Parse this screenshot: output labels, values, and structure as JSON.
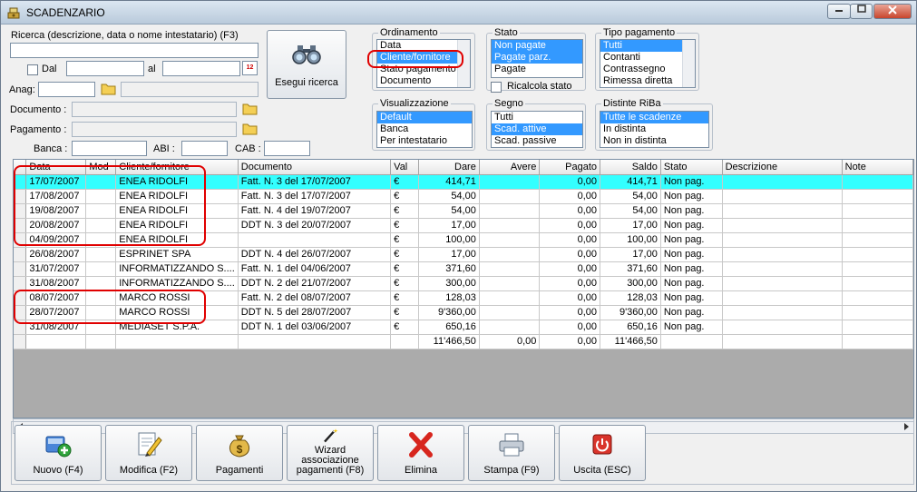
{
  "window": {
    "title": "SCADENZARIO",
    "buttons": [
      "minimize",
      "maximize",
      "close"
    ]
  },
  "search": {
    "label": "Ricerca (descrizione, data o nome intestatario) (F3)",
    "value": "",
    "from_label": "Dal",
    "to_label": "al",
    "anag_label": "Anag:",
    "documento_label": "Documento :",
    "pagamento_label": "Pagamento :",
    "banca_label": "Banca :",
    "abi_label": "ABI :",
    "cab_label": "CAB :",
    "calendar_text": "12",
    "search_button": "Esegui ricerca"
  },
  "ordinamento": {
    "title": "Ordinamento",
    "options": [
      "Data",
      "Cliente/fornitore",
      "Stato pagamento",
      "Documento"
    ],
    "selected": "Cliente/fornitore"
  },
  "stato": {
    "title": "Stato",
    "options": [
      "Non pagate",
      "Pagate parz.",
      "Pagate"
    ],
    "selected": [
      "Non pagate",
      "Pagate parz."
    ],
    "ricalcola_label": "Ricalcola stato"
  },
  "tipo_pagamento": {
    "title": "Tipo pagamento",
    "options": [
      "Tutti",
      "Contanti",
      "Contrassegno",
      "Rimessa diretta"
    ],
    "selected": "Tutti"
  },
  "visualizzazione": {
    "title": "Visualizzazione",
    "options": [
      "Default",
      "Banca",
      "Per intestatario"
    ],
    "selected": "Default"
  },
  "segno": {
    "title": "Segno",
    "options": [
      "Tutti",
      "Scad. attive",
      "Scad. passive"
    ],
    "selected": "Scad. attive"
  },
  "distinte": {
    "title": "Distinte RiBa",
    "options": [
      "Tutte le scadenze",
      "In distinta",
      "Non in distinta"
    ],
    "selected": "Tutte le scadenze"
  },
  "table": {
    "columns": [
      "Data",
      "Mod",
      "Cliente/fornitore",
      "Documento",
      "Val",
      "Dare",
      "Avere",
      "Pagato",
      "Saldo",
      "Stato",
      "Descrizione",
      "Note"
    ],
    "rows": [
      [
        "17/07/2007",
        "",
        "ENEA RIDOLFI",
        "Fatt. N. 3 del 17/07/2007",
        "€",
        "414,71",
        "",
        "0,00",
        "414,71",
        "Non pag.",
        "",
        ""
      ],
      [
        "17/08/2007",
        "",
        "ENEA RIDOLFI",
        "Fatt. N. 3 del 17/07/2007",
        "€",
        "54,00",
        "",
        "0,00",
        "54,00",
        "Non pag.",
        "",
        ""
      ],
      [
        "19/08/2007",
        "",
        "ENEA RIDOLFI",
        "Fatt. N. 4 del 19/07/2007",
        "€",
        "54,00",
        "",
        "0,00",
        "54,00",
        "Non pag.",
        "",
        ""
      ],
      [
        "20/08/2007",
        "",
        "ENEA RIDOLFI",
        "DDT N. 3 del 20/07/2007",
        "€",
        "17,00",
        "",
        "0,00",
        "17,00",
        "Non pag.",
        "",
        ""
      ],
      [
        "04/09/2007",
        "",
        "ENEA RIDOLFI",
        "",
        "€",
        "100,00",
        "",
        "0,00",
        "100,00",
        "Non pag.",
        "",
        ""
      ],
      [
        "26/08/2007",
        "",
        "ESPRINET SPA",
        "DDT N. 4 del 26/07/2007",
        "€",
        "17,00",
        "",
        "0,00",
        "17,00",
        "Non pag.",
        "",
        ""
      ],
      [
        "31/07/2007",
        "",
        "INFORMATIZZANDO S....",
        "Fatt. N. 1 del 04/06/2007",
        "€",
        "371,60",
        "",
        "0,00",
        "371,60",
        "Non pag.",
        "",
        ""
      ],
      [
        "31/08/2007",
        "",
        "INFORMATIZZANDO S....",
        "DDT N. 2 del 21/07/2007",
        "€",
        "300,00",
        "",
        "0,00",
        "300,00",
        "Non pag.",
        "",
        ""
      ],
      [
        "08/07/2007",
        "",
        "MARCO ROSSI",
        "Fatt. N. 2 del 08/07/2007",
        "€",
        "128,03",
        "",
        "0,00",
        "128,03",
        "Non pag.",
        "",
        ""
      ],
      [
        "28/07/2007",
        "",
        "MARCO ROSSI",
        "DDT N. 5 del 28/07/2007",
        "€",
        "9'360,00",
        "",
        "0,00",
        "9'360,00",
        "Non pag.",
        "",
        ""
      ],
      [
        "31/08/2007",
        "",
        "MEDIASET S.P.A.",
        "DDT N. 1 del 03/06/2007",
        "€",
        "650,16",
        "",
        "0,00",
        "650,16",
        "Non pag.",
        "",
        ""
      ]
    ],
    "totals": [
      "",
      "",
      "",
      "",
      "",
      "11'466,50",
      "0,00",
      "0,00",
      "11'466,50",
      "",
      "",
      ""
    ]
  },
  "toolbar": [
    {
      "label": "Nuovo (F4)",
      "icon": "new-record-icon"
    },
    {
      "label": "Modifica (F2)",
      "icon": "edit-icon"
    },
    {
      "label": "Pagamenti",
      "icon": "money-bag-icon"
    },
    {
      "label": "Wizard associazione pagamenti (F8)",
      "icon": "wizard-wand-icon"
    },
    {
      "label": "Elimina",
      "icon": "delete-x-icon"
    },
    {
      "label": "Stampa (F9)",
      "icon": "printer-icon"
    },
    {
      "label": "Uscita (ESC)",
      "icon": "exit-power-icon"
    }
  ],
  "colors": {
    "highlight_row": "#33ffff",
    "selection": "#3399ff",
    "annotation": "#e00000"
  }
}
